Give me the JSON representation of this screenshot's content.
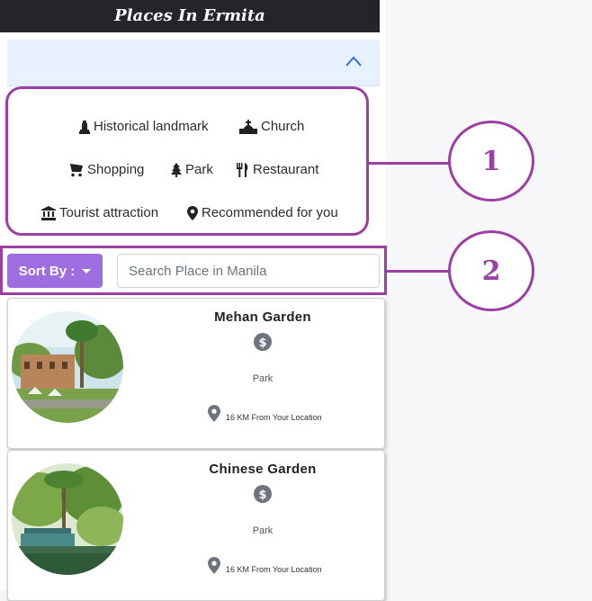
{
  "header": {
    "title": "Places In Ermita"
  },
  "categories": [
    {
      "label": "Historical landmark",
      "icon": "landmark-icon"
    },
    {
      "label": "Church",
      "icon": "church-icon"
    },
    {
      "label": "Shopping",
      "icon": "cart-icon"
    },
    {
      "label": "Park",
      "icon": "tree-icon"
    },
    {
      "label": "Restaurant",
      "icon": "utensils-icon"
    },
    {
      "label": "Tourist attraction",
      "icon": "museum-icon"
    },
    {
      "label": "Recommended for you",
      "icon": "map-marker-icon"
    }
  ],
  "toolbar": {
    "sort_label": "Sort By :",
    "search_placeholder": "Search Place in Manila"
  },
  "callouts": [
    "1",
    "2"
  ],
  "places": [
    {
      "name": "Mehan Garden",
      "type": "Park",
      "distance": "16 KM",
      "distance_suffix": "From Your Location"
    },
    {
      "name": "Chinese Garden",
      "type": "Park",
      "distance": "16 KM",
      "distance_suffix": "From Your Location"
    }
  ],
  "colors": {
    "accent": "#9e6ee0",
    "callout": "#9b3fa3",
    "header": "#23252a",
    "accordion": "#e7f1ff"
  }
}
